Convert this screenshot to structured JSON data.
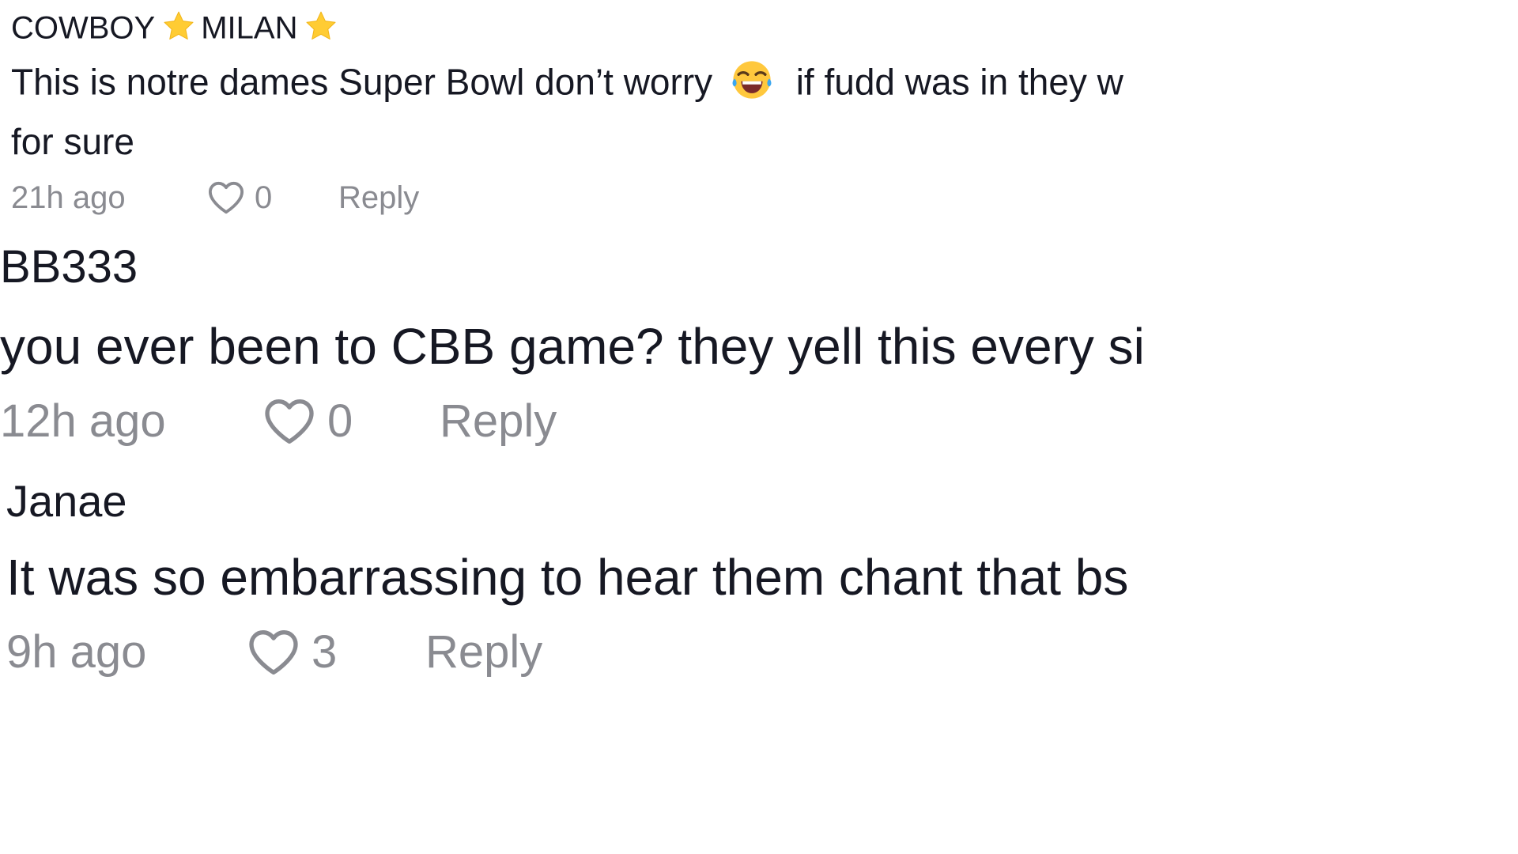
{
  "comments": [
    {
      "username_part1": "COWBOY",
      "username_part2": "MILAN",
      "username_icon": "star-emoji",
      "text_part1": "This is notre dames Super Bowl don’t worry",
      "emoji": "face-with-tears-of-joy-emoji",
      "text_part2": "if fudd was in they w",
      "text_line2": "for sure",
      "time": "21h ago",
      "likes": "0",
      "reply_label": "Reply"
    },
    {
      "username": "BB333",
      "text": "you ever been to CBB game? they yell this every si",
      "time": "12h ago",
      "likes": "0",
      "reply_label": "Reply"
    },
    {
      "username": "Janae",
      "text": "It was so embarrassing to hear them chant that bs",
      "time": "9h ago",
      "likes": "3",
      "reply_label": "Reply"
    }
  ],
  "colors": {
    "text": "#161823",
    "meta": "#8a8b91",
    "star": "#FFCC33"
  }
}
